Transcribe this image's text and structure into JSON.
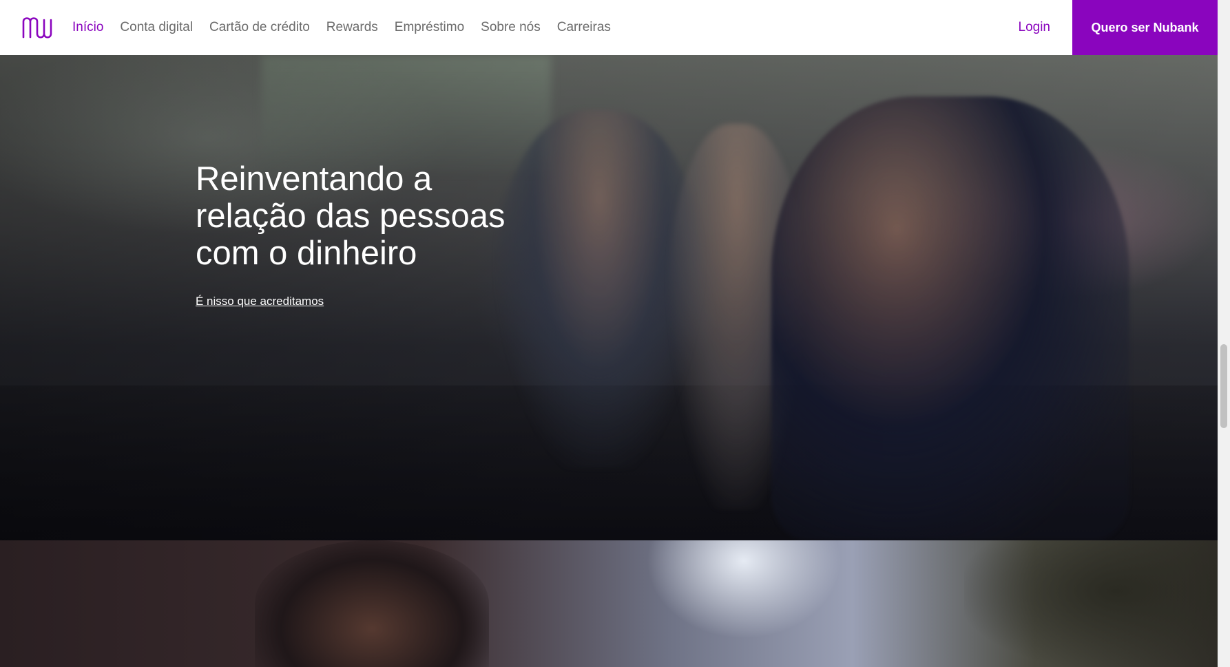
{
  "brand": {
    "logo_icon": "nu-logo",
    "accent_color": "#8a05be"
  },
  "nav": {
    "links": [
      {
        "label": "Início",
        "active": true
      },
      {
        "label": "Conta digital",
        "active": false
      },
      {
        "label": "Cartão de crédito",
        "active": false
      },
      {
        "label": "Rewards",
        "active": false
      },
      {
        "label": "Empréstimo",
        "active": false
      },
      {
        "label": "Sobre nós",
        "active": false
      },
      {
        "label": "Carreiras",
        "active": false
      }
    ],
    "login_label": "Login",
    "cta_label": "Quero ser Nubank"
  },
  "hero": {
    "title_lines": [
      "Reinventando a",
      "relação das pessoas",
      "com o dinheiro"
    ],
    "link_label": "É nisso que acreditamos"
  }
}
